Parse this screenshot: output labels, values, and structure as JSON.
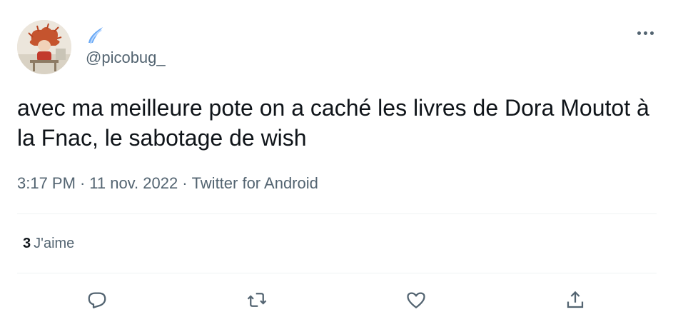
{
  "colors": {
    "text_primary": "#0f1419",
    "text_secondary": "#536471",
    "divider": "#eff3f4",
    "display_name_icon": "#6aa9f5"
  },
  "author": {
    "display_name_icon": "comet-icon",
    "handle": "@picobug_"
  },
  "tweet": {
    "text": "avec ma meilleure pote on a caché les livres de Dora Moutot à la Fnac, le sabotage de wish",
    "time": "3:17 PM",
    "date": "11 nov. 2022",
    "source": "Twitter for Android",
    "separator": "·"
  },
  "stats": {
    "likes_count": "3",
    "likes_label": "J'aime"
  },
  "actions": [
    {
      "name": "reply",
      "icon": "reply-icon"
    },
    {
      "name": "retweet",
      "icon": "retweet-icon"
    },
    {
      "name": "like",
      "icon": "heart-icon"
    },
    {
      "name": "share",
      "icon": "share-icon"
    }
  ]
}
